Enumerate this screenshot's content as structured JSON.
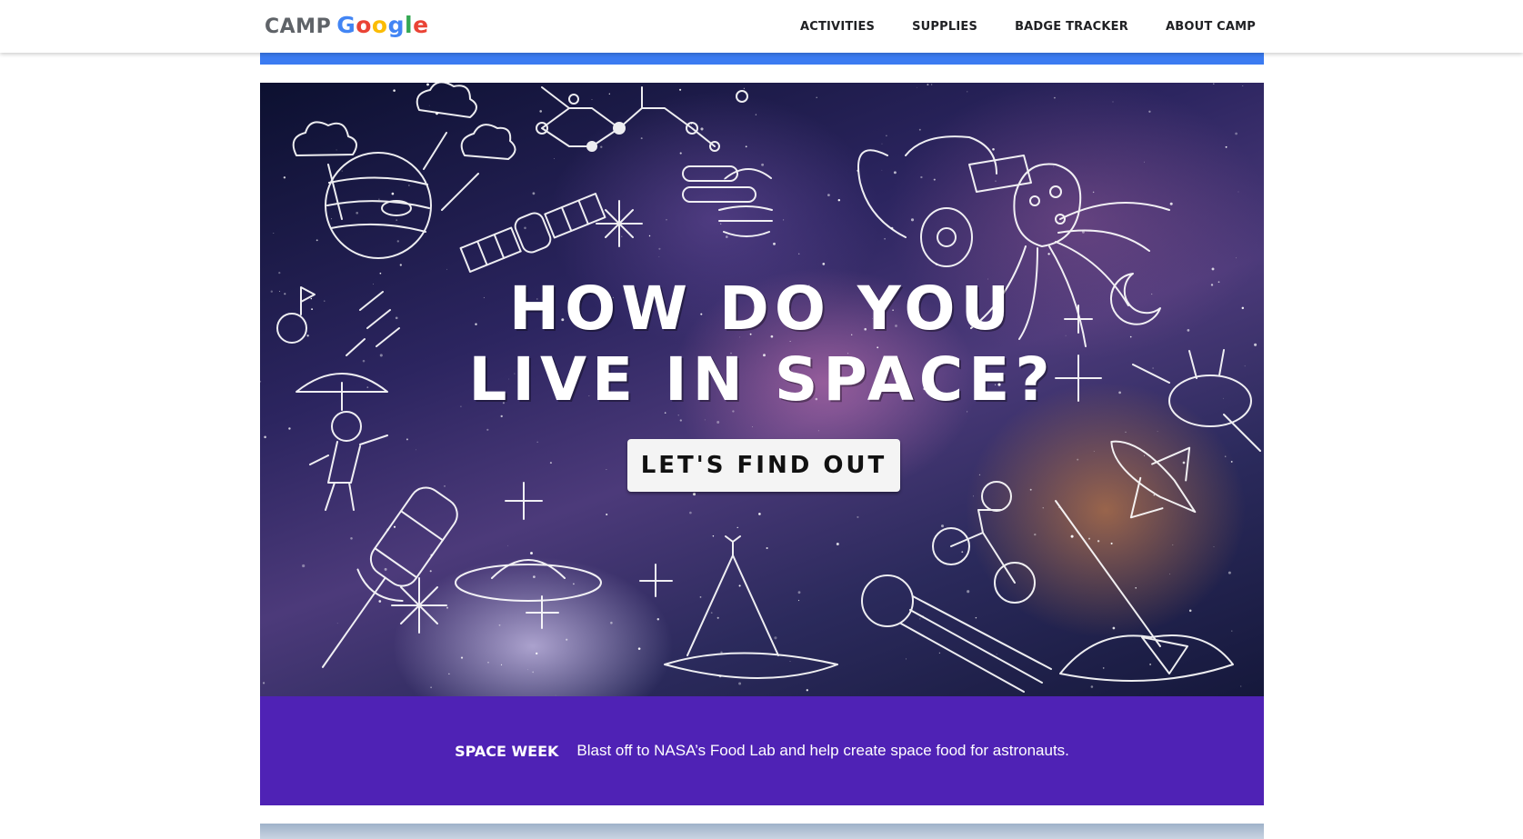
{
  "header": {
    "logo": {
      "camp": "CAMP",
      "google_letters": [
        "G",
        "o",
        "o",
        "g",
        "l",
        "e"
      ],
      "google_colors": [
        "#4285F4",
        "#EA4335",
        "#FBBC05",
        "#4285F4",
        "#34A853",
        "#EA4335"
      ]
    },
    "nav": [
      {
        "label": "ACTIVITIES"
      },
      {
        "label": "SUPPLIES"
      },
      {
        "label": "BADGE TRACKER"
      },
      {
        "label": "ABOUT CAMP"
      }
    ]
  },
  "colors": {
    "accent_bar": "#3b7bf1",
    "banner": "#4f22b5"
  },
  "hero": {
    "title_line1": "HOW DO YOU",
    "title_line2": "LIVE IN SPACE?",
    "cta_label": "LET'S FIND OUT"
  },
  "banner": {
    "label": "SPACE WEEK",
    "text": "Blast off to NASA’s Food Lab and help create space food for astronauts."
  }
}
